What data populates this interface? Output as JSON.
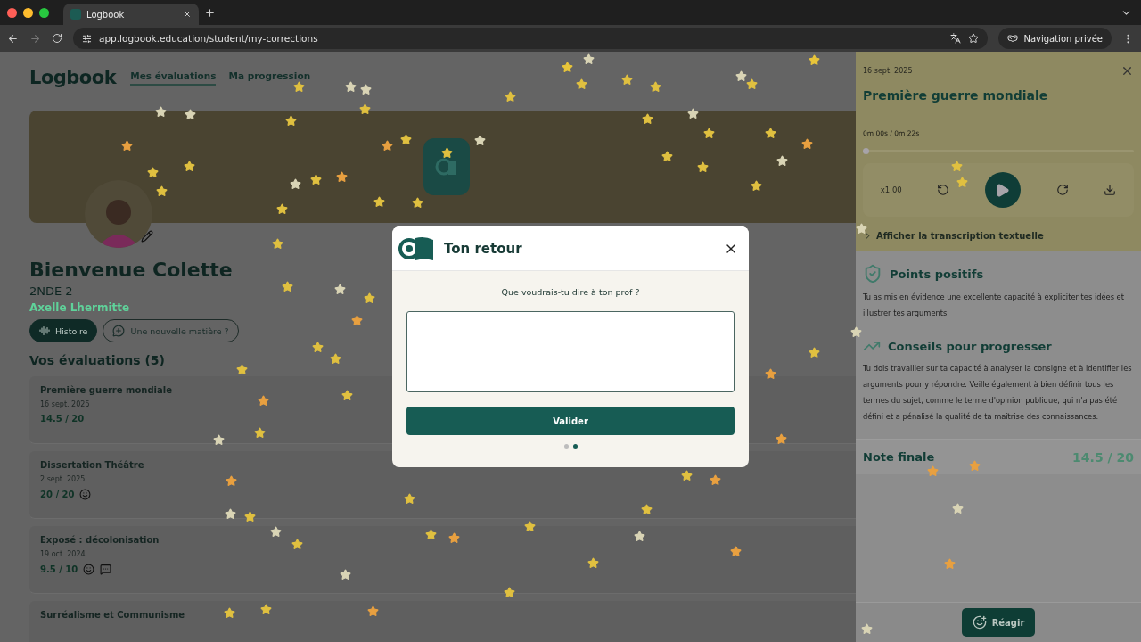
{
  "browser": {
    "tab_title": "Logbook",
    "url": "app.logbook.education/student/my-corrections",
    "private_label": "Navigation privée"
  },
  "app": {
    "logo": "Logbook",
    "nav": [
      {
        "label": "Mes évaluations",
        "selected": true
      },
      {
        "label": "Ma progression",
        "selected": false
      }
    ],
    "profile": {
      "greeting": "Bienvenue Colette",
      "class_name": "2NDE 2",
      "teacher": "Axelle Lhermitte"
    },
    "subjects": [
      {
        "label": "Histoire",
        "kind": "subject",
        "selected": true
      },
      {
        "label": "Une nouvelle matière ?",
        "kind": "add",
        "selected": false
      }
    ],
    "evaluations_title": "Vos évaluations (5)",
    "evaluations": [
      {
        "title": "Première guerre mondiale",
        "date": "16 sept. 2025",
        "grade": "14.5 / 20",
        "reaction": false,
        "comment": false
      },
      {
        "title": "Dissertation Théâtre",
        "date": "2 sept. 2025",
        "grade": "20 / 20",
        "reaction": true,
        "comment": false
      },
      {
        "title": "Exposé : décolonisation",
        "date": "19 oct. 2024",
        "grade": "9.5 / 10",
        "reaction": true,
        "comment": true
      },
      {
        "title": "Surréalisme et Communisme",
        "reaction": false,
        "comment": false
      }
    ]
  },
  "panel": {
    "date": "16 sept. 2025",
    "title": "Première guerre mondiale",
    "audio": {
      "time": "0m 00s / 0m 22s",
      "level": 0,
      "speed": "x1.00"
    },
    "transcript_link": "Afficher la transcription textuelle",
    "sections": [
      {
        "kind": "positive",
        "title": "Points positifs",
        "text": "Tu as mis en évidence une excellente capacité à expliciter tes idées et illustrer tes arguments."
      },
      {
        "kind": "advice",
        "title": "Conseils pour progresser",
        "text": "Tu dois travailler sur ta capacité à analyser la consigne et à identifier les arguments pour y répondre. Veille également à bien définir tous les termes du sujet, comme le terme d'opinion publique, qui n'a pas été défini et a pénalisé la qualité de ta maîtrise des connaissances."
      }
    ],
    "final": {
      "label": "Note finale",
      "grade": "14.5 / 20"
    },
    "react_button": "Réagir"
  },
  "modal": {
    "title": "Ton retour",
    "question": "Que voudrais-tu dire à ton prof ?",
    "submit": "Valider",
    "steps": [
      {
        "selected": false
      },
      {
        "selected": true
      }
    ]
  }
}
